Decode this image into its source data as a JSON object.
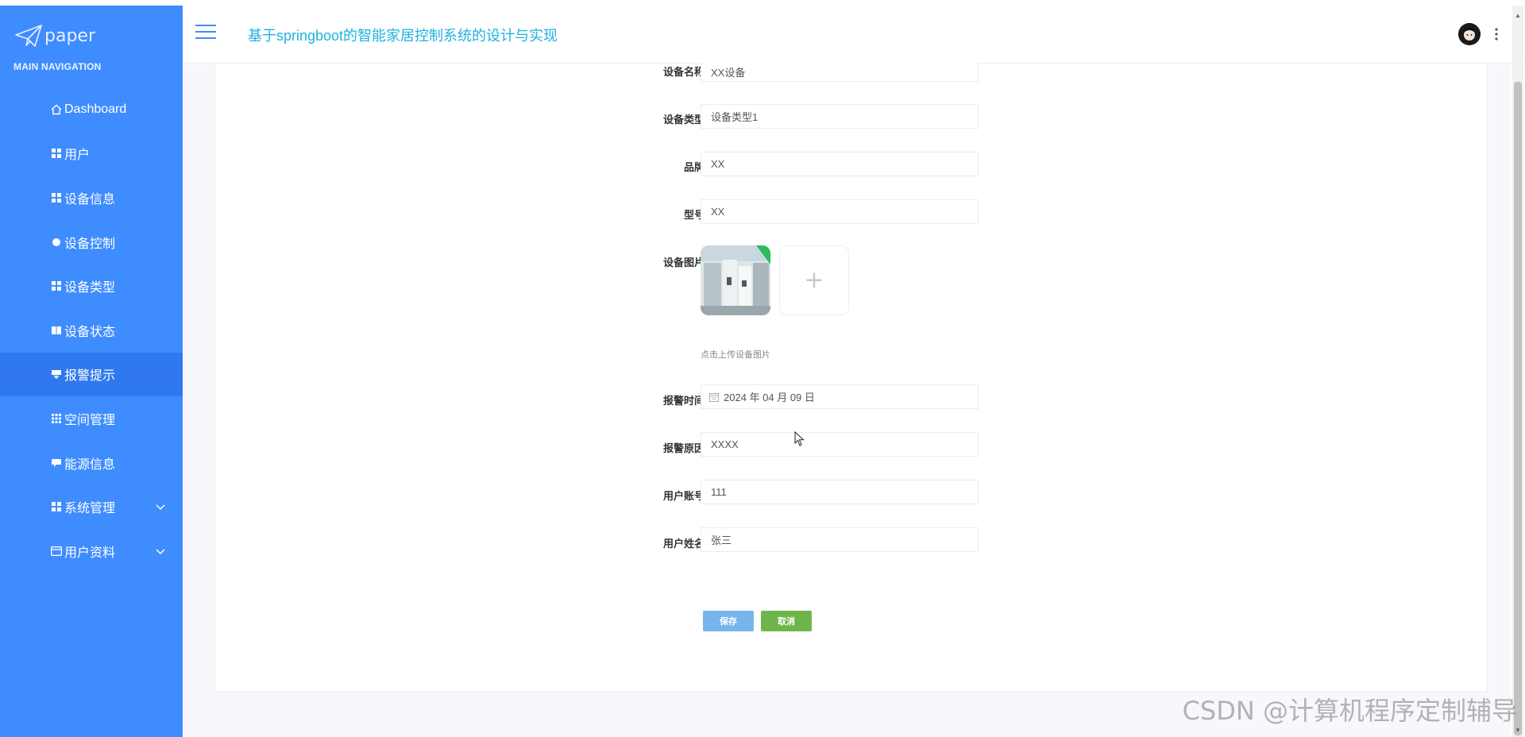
{
  "app": {
    "logo_text": "paper",
    "title": "基于springboot的智能家居控制系统的设计与实现"
  },
  "sidebar": {
    "heading": "MAIN NAVIGATION",
    "items": [
      {
        "label": "Dashboard",
        "icon": "home-icon"
      },
      {
        "label": "用户",
        "icon": "grid-icon"
      },
      {
        "label": "设备信息",
        "icon": "grid-icon"
      },
      {
        "label": "设备控制",
        "icon": "circle-icon"
      },
      {
        "label": "设备类型",
        "icon": "grid-icon"
      },
      {
        "label": "设备状态",
        "icon": "book-icon"
      },
      {
        "label": "报警提示",
        "icon": "bell-icon",
        "active": true
      },
      {
        "label": "空间管理",
        "icon": "grid9-icon"
      },
      {
        "label": "能源信息",
        "icon": "chat-icon"
      },
      {
        "label": "系统管理",
        "icon": "grid-icon",
        "expandable": true
      },
      {
        "label": "用户资料",
        "icon": "card-icon",
        "expandable": true
      }
    ]
  },
  "form": {
    "device_name": {
      "label": "设备名称",
      "value": "XX设备"
    },
    "device_type": {
      "label": "设备类型",
      "value": "设备类型1"
    },
    "brand": {
      "label": "品牌",
      "value": "XX"
    },
    "model": {
      "label": "型号",
      "value": "XX"
    },
    "device_image": {
      "label": "设备图片",
      "hint": "点击上传设备图片"
    },
    "alarm_time": {
      "label": "报警时间",
      "value": "2024 年 04 月 09 日"
    },
    "alarm_reason": {
      "label": "报警原因",
      "value": "XXXX"
    },
    "user_account": {
      "label": "用户账号",
      "value": "111"
    },
    "user_name": {
      "label": "用户姓名",
      "value": "张三"
    }
  },
  "buttons": {
    "save": "保存",
    "cancel": "取消"
  },
  "watermark": "CSDN @计算机程序定制辅导",
  "colors": {
    "sidebar": "#3f8cff",
    "active": "#2f78f0",
    "title": "#1fb1e0",
    "save": "#78b5ec",
    "cancel": "#6fb64a"
  }
}
